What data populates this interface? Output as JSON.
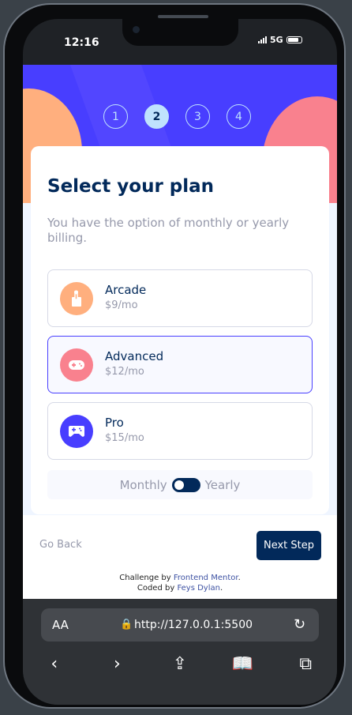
{
  "status": {
    "time": "12:16",
    "network": "5G"
  },
  "steps": [
    "1",
    "2",
    "3",
    "4"
  ],
  "active_step": 2,
  "form": {
    "title": "Select your plan",
    "description": "You have the option of monthly or yearly billing.",
    "plans": [
      {
        "name": "Arcade",
        "price": "$9/mo",
        "icon": "arcade-icon",
        "color": "#ffaf7e"
      },
      {
        "name": "Advanced",
        "price": "$12/mo",
        "icon": "gamepad-icon",
        "color": "#f9818e"
      },
      {
        "name": "Pro",
        "price": "$15/mo",
        "icon": "pro-controller-icon",
        "color": "#483eff"
      }
    ],
    "selected_plan": "Advanced",
    "billing": {
      "monthly_label": "Monthly",
      "yearly_label": "Yearly",
      "selected": "Monthly"
    }
  },
  "footer": {
    "back_label": "Go Back",
    "next_label": "Next Step",
    "attribution_line1": "Challenge by",
    "attribution_link1": "Frontend Mentor",
    "attribution_line2": "Coded by",
    "attribution_link2": "Feys Dylan"
  },
  "browser": {
    "aa_label": "AA",
    "url": "http://127.0.0.1:5500"
  },
  "colors": {
    "primary": "#02295a",
    "accent": "#483eff",
    "step_active": "#bfe2fd"
  }
}
